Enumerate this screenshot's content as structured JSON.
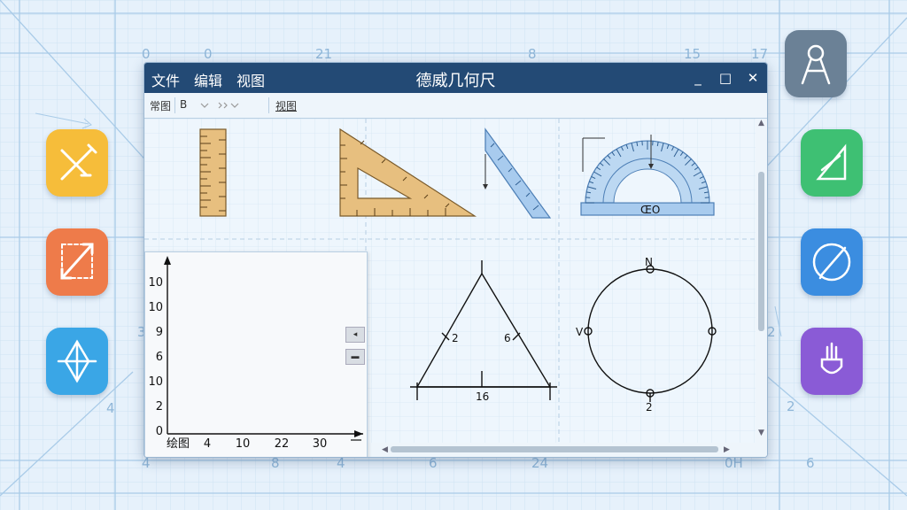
{
  "background": {
    "numbers": [
      "0",
      "0",
      "21",
      "8",
      "15",
      "17",
      "3",
      "2",
      "4",
      "4",
      "8",
      "4",
      "2",
      "24",
      "6",
      "0H",
      "6"
    ]
  },
  "dock_left": [
    {
      "name": "ruler-pencil-app-icon",
      "color": "#f6bd3a"
    },
    {
      "name": "diagonal-measure-app-icon",
      "color": "#ee7b4a"
    },
    {
      "name": "compass-star-app-icon",
      "color": "#3aa6e6"
    }
  ],
  "dock_right": [
    {
      "name": "drawing-compass-app-icon",
      "color": "#6b8196"
    },
    {
      "name": "triangle-pencil-app-icon",
      "color": "#3ec073"
    },
    {
      "name": "pen-circle-app-icon",
      "color": "#3b8de0"
    },
    {
      "name": "shield-plug-app-icon",
      "color": "#8a5bd6"
    }
  ],
  "window": {
    "menu": [
      "文件",
      "编辑",
      "视图"
    ],
    "title": "德威几何尺",
    "controls": [
      "_",
      "□",
      "✕"
    ],
    "toolbar": {
      "item1": "常图",
      "item2": "B",
      "item3": "视图"
    }
  },
  "tools": {
    "protractor_label": "ŒO"
  },
  "chart_data": {
    "type": "line",
    "title": "",
    "xlabel": "绘图",
    "ylabel": "",
    "y_tick_labels": [
      "10",
      "10",
      "9",
      "6",
      "10",
      "2",
      "0"
    ],
    "x_tick_labels": [
      "4",
      "10",
      "22",
      "30"
    ],
    "series": []
  },
  "triangle": {
    "left_label": "2",
    "right_label": "6",
    "base_label": "16"
  },
  "circle": {
    "top_label": "N",
    "left_label": "V",
    "bottom_label": "2"
  }
}
